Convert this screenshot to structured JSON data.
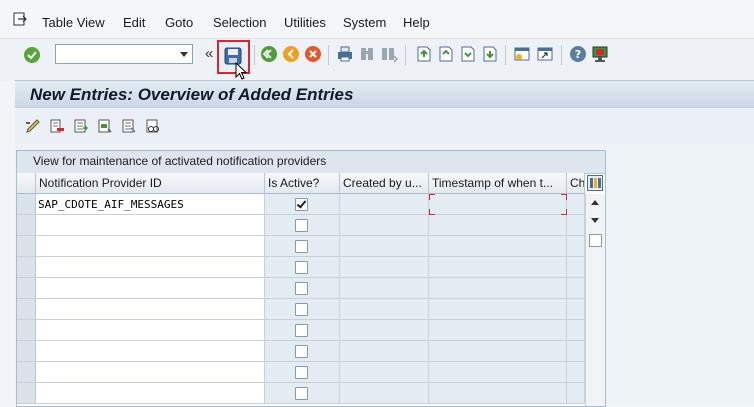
{
  "menu": {
    "items": [
      "Table View",
      "Edit",
      "Goto",
      "Selection",
      "Utilities",
      "System",
      "Help"
    ]
  },
  "toolbar": {
    "command_field": {
      "value": "",
      "placeholder": ""
    },
    "save_tooltip": ""
  },
  "page": {
    "title": "New Entries: Overview of Added Entries"
  },
  "table": {
    "title": "View for maintenance of activated notification providers",
    "columns": [
      "Notification Provider ID",
      "Is Active?",
      "Created by u...",
      "Timestamp of when t...",
      "Cha"
    ],
    "rows": [
      {
        "provider_id": "SAP_CDOTE_AIF_MESSAGES",
        "is_active": true
      },
      {
        "provider_id": "",
        "is_active": false
      },
      {
        "provider_id": "",
        "is_active": false
      },
      {
        "provider_id": "",
        "is_active": false
      },
      {
        "provider_id": "",
        "is_active": false
      },
      {
        "provider_id": "",
        "is_active": false
      },
      {
        "provider_id": "",
        "is_active": false
      },
      {
        "provider_id": "",
        "is_active": false
      },
      {
        "provider_id": "",
        "is_active": false
      },
      {
        "provider_id": "",
        "is_active": false
      }
    ]
  },
  "colors": {
    "highlight_border": "#d9262c",
    "title_bar": "#c9d7e3",
    "readonly_cell": "#e3ebf3"
  },
  "icons": {
    "toolbar": [
      "enter-check-icon",
      "command-dropdown-icon",
      "collapse-chevrons-icon",
      "save-icon",
      "back-icon",
      "exit-icon",
      "cancel-icon",
      "print-icon",
      "find-icon",
      "find-next-icon",
      "first-page-icon",
      "previous-page-icon",
      "next-page-icon",
      "last-page-icon",
      "create-session-icon",
      "shortcut-icon",
      "help-icon",
      "customize-layout-icon"
    ],
    "app_toolbar": [
      "change-display-icon",
      "delete-icon",
      "select-all-icon",
      "select-block-icon",
      "deselect-all-icon",
      "print-view-icon"
    ]
  }
}
